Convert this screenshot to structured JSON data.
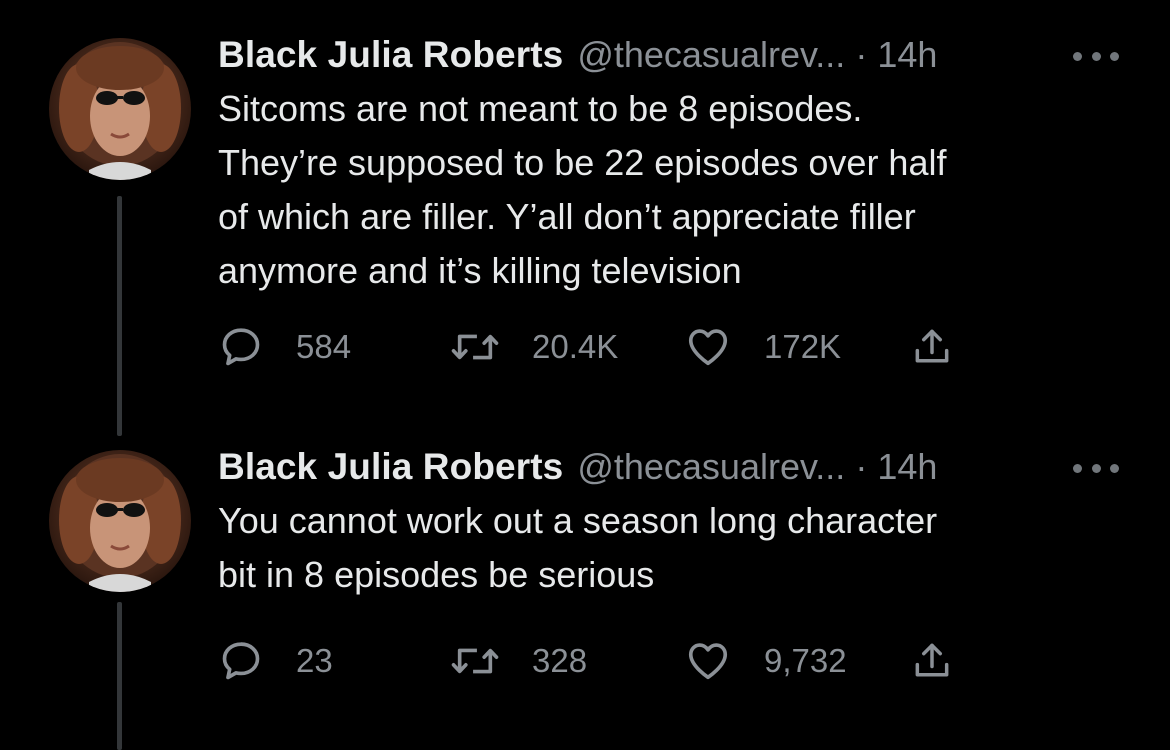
{
  "colors": {
    "background": "#000000",
    "text_primary": "#e7e9ea",
    "text_secondary": "#8b9096",
    "thread_line": "#333639"
  },
  "tweets": [
    {
      "display_name": "Black Julia Roberts",
      "handle": "@thecasualrev...",
      "separator": "·",
      "time": "14h",
      "avatar_icon": "profile-photo",
      "more_icon": "more-icon",
      "text_lines": [
        "Sitcoms are not meant to be 8 episodes.",
        "They’re supposed to be 22 episodes over half",
        "of which are filler. Y’all don’t appreciate filler",
        "anymore and it’s killing television"
      ],
      "replies": "584",
      "retweets": "20.4K",
      "likes": "172K"
    },
    {
      "display_name": "Black Julia Roberts",
      "handle": "@thecasualrev...",
      "separator": "·",
      "time": "14h",
      "avatar_icon": "profile-photo",
      "more_icon": "more-icon",
      "text_lines": [
        "You cannot work out a season long character",
        "bit in 8 episodes be serious"
      ],
      "replies": "23",
      "retweets": "328",
      "likes": "9,732"
    }
  ]
}
